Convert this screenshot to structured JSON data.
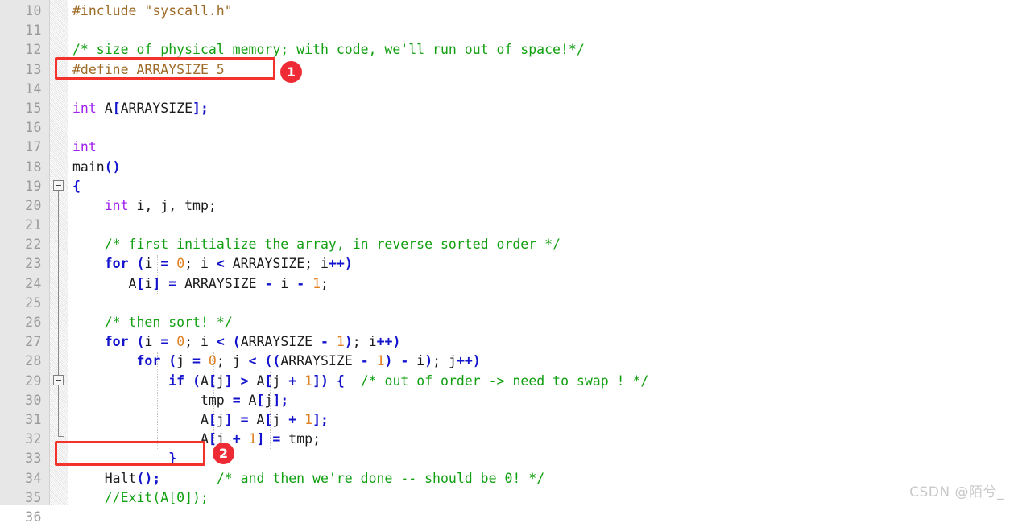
{
  "editor": {
    "language": "c",
    "first_line_number": 10,
    "colors": {
      "preprocessor": "#9e6b26",
      "comment": "#11a011",
      "keyword": "#1414cd",
      "type": "#a020f0",
      "number": "#e08020",
      "plain": "#1a1a1a",
      "gutter_bg": "#e7e7e7",
      "gutter_fg": "#9a9a9a",
      "editor_bg": "#ffffff",
      "annotation": "#f4322b",
      "badge": "#ee2b35"
    },
    "line_numbers": [
      "10",
      "11",
      "12",
      "13",
      "14",
      "15",
      "16",
      "17",
      "18",
      "19",
      "20",
      "21",
      "22",
      "23",
      "24",
      "25",
      "26",
      "27",
      "28",
      "29",
      "30",
      "31",
      "32",
      "33",
      "34",
      "35",
      "36"
    ],
    "lines": [
      {
        "n": "10",
        "text": "#include \"syscall.h\""
      },
      {
        "n": "11",
        "text": ""
      },
      {
        "n": "12",
        "text": "/* size of physical memory; with code, we'll run out of space!*/"
      },
      {
        "n": "13",
        "text": "#define ARRAYSIZE 5"
      },
      {
        "n": "14",
        "text": ""
      },
      {
        "n": "15",
        "text": "int A[ARRAYSIZE];"
      },
      {
        "n": "16",
        "text": ""
      },
      {
        "n": "17",
        "text": "int"
      },
      {
        "n": "18",
        "text": "main()"
      },
      {
        "n": "19",
        "text": "{"
      },
      {
        "n": "20",
        "text": "    int i, j, tmp;"
      },
      {
        "n": "21",
        "text": ""
      },
      {
        "n": "22",
        "text": "    /* first initialize the array, in reverse sorted order */"
      },
      {
        "n": "23",
        "text": "    for (i = 0; i < ARRAYSIZE; i++)"
      },
      {
        "n": "24",
        "text": "       A[i] = ARRAYSIZE - i - 1;"
      },
      {
        "n": "25",
        "text": ""
      },
      {
        "n": "26",
        "text": "    /* then sort! */"
      },
      {
        "n": "27",
        "text": "    for (i = 0; i < (ARRAYSIZE - 1); i++)"
      },
      {
        "n": "28",
        "text": "        for (j = 0; j < ((ARRAYSIZE - 1) - i); j++)"
      },
      {
        "n": "29",
        "text": "            if (A[j] > A[j + 1]) {  /* out of order -> need to swap ! */"
      },
      {
        "n": "30",
        "text": "                tmp = A[j];"
      },
      {
        "n": "31",
        "text": "                A[j] = A[j + 1];"
      },
      {
        "n": "32",
        "text": "                A[j + 1] = tmp;"
      },
      {
        "n": "33",
        "text": "            }"
      },
      {
        "n": "34",
        "text": "    Halt();       /* and then we're done -- should be 0! */"
      },
      {
        "n": "35",
        "text": "    //Exit(A[0]);"
      },
      {
        "n": "36",
        "text": "}"
      }
    ],
    "fold_markers": [
      {
        "line": "19",
        "state": "expanded"
      },
      {
        "line": "29",
        "state": "expanded"
      }
    ]
  },
  "annotations": [
    {
      "id": "1",
      "label": "1",
      "target_line": "13",
      "target_text": "#define ARRAYSIZE 5"
    },
    {
      "id": "2",
      "label": "2",
      "target_line": "34",
      "target_text": "Halt();"
    }
  ],
  "watermark": {
    "text": "CSDN @陌兮_"
  }
}
